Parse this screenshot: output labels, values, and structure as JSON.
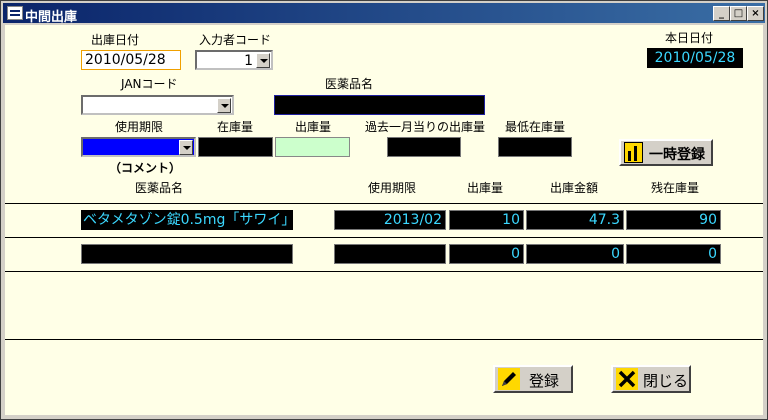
{
  "window": {
    "title": "中間出庫"
  },
  "header": {
    "date_label": "出庫日付",
    "date_value": "2010/05/28",
    "code_label": "入力者コード",
    "code_value": "1",
    "today_label": "本日日付",
    "today_value": "2010/05/28",
    "jan_label": "JANコード",
    "jan_value": "",
    "drug_label": "医薬品名",
    "drug_value": "",
    "expiry_label": "使用期限",
    "stock_label": "在庫量",
    "out_label": "出庫量",
    "monthly_label": "過去一月当りの出庫量",
    "min_label": "最低在庫量",
    "comment_label": "（コメント）",
    "temp_save_label": "一時登録"
  },
  "table": {
    "columns": [
      "医薬品名",
      "使用期限",
      "出庫量",
      "出庫金額",
      "残在庫量"
    ],
    "rows": [
      {
        "name": "ベタメタゾン錠0.5mg「サワイ」",
        "expiry": "2013/02",
        "qty": "10",
        "amount": "47.3",
        "remain": "90"
      },
      {
        "name": "",
        "expiry": "",
        "qty": "0",
        "amount": "0",
        "remain": "0"
      }
    ]
  },
  "footer": {
    "register_label": "登録",
    "close_label": "閉じる"
  },
  "colors": {
    "title_bar": "#0a246a",
    "form_bg": "#ffffe7",
    "field_text": "#3bd8ff",
    "out_field": "#ccffcc",
    "expiry_field": "#0000ff"
  }
}
